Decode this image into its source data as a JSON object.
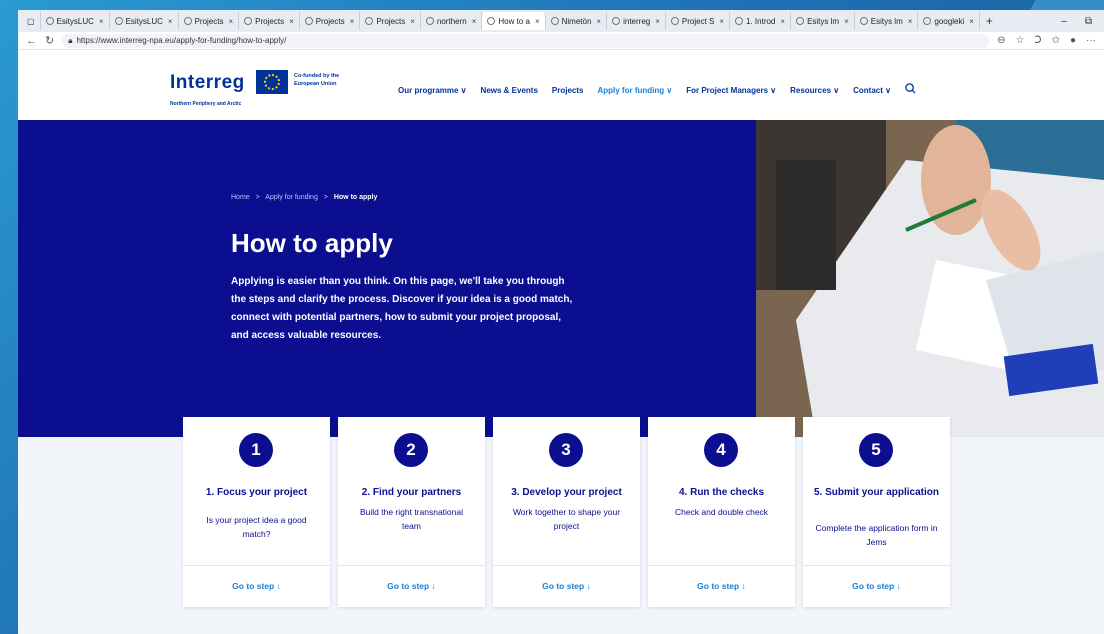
{
  "tabs": [
    {
      "label": "EsitysLUC",
      "active": false
    },
    {
      "label": "EsitysLUC",
      "active": false
    },
    {
      "label": "Projects",
      "active": false
    },
    {
      "label": "Projects",
      "active": false
    },
    {
      "label": "Projects",
      "active": false
    },
    {
      "label": "Projects",
      "active": false
    },
    {
      "label": "northern",
      "active": false
    },
    {
      "label": "How to a",
      "active": true
    },
    {
      "label": "Nimetön",
      "active": false
    },
    {
      "label": "interreg",
      "active": false
    },
    {
      "label": "Project S",
      "active": false
    },
    {
      "label": "1. Introd",
      "active": false
    },
    {
      "label": "Esitys lm",
      "active": false
    },
    {
      "label": "Esitys lm",
      "active": false
    },
    {
      "label": "googleki",
      "active": false
    }
  ],
  "url": "https://www.interreg-npa.eu/apply-for-funding/how-to-apply/",
  "logo": {
    "name": "Interreg",
    "cofunded": "Co-funded by the European Union",
    "subtitle": "Northern Periphery and Arctic"
  },
  "nav": {
    "items": [
      {
        "label": "Our programme ∨",
        "active": false
      },
      {
        "label": "News & Events",
        "active": false
      },
      {
        "label": "Projects",
        "active": false
      },
      {
        "label": "Apply for funding ∨",
        "active": true
      },
      {
        "label": "For Project Managers ∨",
        "active": false
      },
      {
        "label": "Resources ∨",
        "active": false
      },
      {
        "label": "Contact ∨",
        "active": false
      }
    ]
  },
  "breadcrumb": {
    "home": "Home",
    "parent": "Apply for funding",
    "current": "How to apply",
    "sep": ">"
  },
  "hero": {
    "title": "How to apply",
    "text": "Applying is easier than you think. On this page, we'll take you through the steps and clarify the process. Discover if your idea is a good match, connect with potential partners, how to submit your project proposal, and access valuable resources."
  },
  "steps": [
    {
      "num": "1",
      "title": "1. Focus your project",
      "desc": "Is your project idea a good match?",
      "link": "Go to step ↓"
    },
    {
      "num": "2",
      "title": "2. Find your partners",
      "desc": "Build the right transnational team",
      "link": "Go to step ↓"
    },
    {
      "num": "3",
      "title": "3. Develop your project",
      "desc": "Work together to shape your project",
      "link": "Go to step ↓"
    },
    {
      "num": "4",
      "title": "4. Run the checks",
      "desc": "Check and double check",
      "link": "Go to step ↓"
    },
    {
      "num": "5",
      "title": "5. Submit your application",
      "desc": "Complete the application form in Jems",
      "link": "Go to step ↓"
    }
  ],
  "colors": {
    "hero_bg": "#0a0e8f",
    "link": "#1a7fd4",
    "brand": "#003399"
  }
}
